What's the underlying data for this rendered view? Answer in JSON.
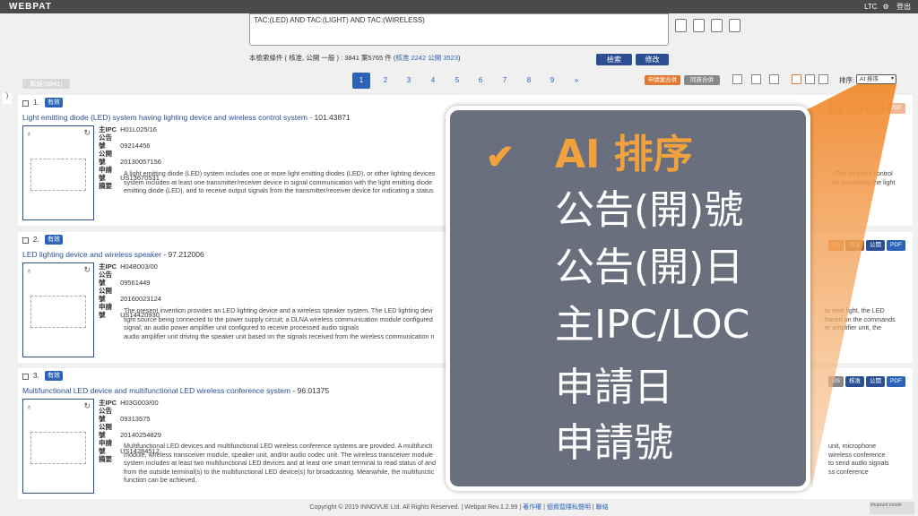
{
  "app": {
    "logo": "WEBPAT",
    "user": "LTC",
    "logout": "登出"
  },
  "search": {
    "query": "TAC:(LED) AND TAC:(LIGHT) AND TAC:(WIRELESS)",
    "info_prefix": "本檢索條件 ( 核准, 公開 一般 ) : 3841 案5765 件 (",
    "granted": "核准 2242",
    "published": "公開 3523",
    "info_suffix": ")",
    "search_btn": "檢索",
    "edit_btn": "修改"
  },
  "count_pill": "聯紙(3841)",
  "pagination": {
    "pages": [
      "1",
      "2",
      "3",
      "4",
      "5",
      "6",
      "7",
      "8",
      "9",
      "»"
    ],
    "active": "1"
  },
  "toolbar": {
    "merge_app": "申請案合併",
    "merge_family": "同族合併",
    "sort_label": "排序:",
    "sort_value": "AI 排序"
  },
  "results": [
    {
      "num": "1.",
      "status": "有效",
      "title": "Light emitting diode (LED) system having lighting device and wireless control system",
      "score": " - 101.43871",
      "ipc": "H01L025/16",
      "pub_no": "09214456",
      "pub_date": "20130057156",
      "app_no": "US13670531",
      "abstract": [
        "A light emitting diode (LED) system includes one or more light emitting diodes (LED), or other lighting devices",
        "system includes at least one transmitter/receiver device in signal communication with the light emitting diode",
        "emitting diode (LED), and to receive output signals from the transmitter/receiver device for indicating a status"
      ],
      "abstract_right": [
        ". The wireless control",
        "for controlling the light",
        ""
      ],
      "btns": [
        "US",
        "核准",
        "公開",
        "PDF"
      ]
    },
    {
      "num": "2.",
      "status": "有效",
      "title": "LED lighting device and wireless speaker",
      "score": " - 97.212006",
      "ipc": "H04B003/00",
      "pub_no": "09561449",
      "pub_date": "20160023124",
      "app_no": "US14420930",
      "abstract": [
        "The present invention provides an LED lighting device and a wireless speaker system. The LED lighting devi",
        "light source being connected to the power supply circuit; a DLNA wireless communication module configured",
        "signal; an audio power amplifier unit configured to receive processed audio signals",
        "audio amplifier unit driving the speaker unit based on the signals received from the wireless communication n"
      ],
      "abstract_right": [
        "to emit light, the LED",
        "based on the commands",
        "er amplifier unit, the",
        ""
      ],
      "btns": [
        "US",
        "核准",
        "公開",
        "PDF"
      ]
    },
    {
      "num": "3.",
      "status": "有效",
      "title": "Multifunctional LED device and multifunctional LED wireless conference system",
      "score": " - 96.01375",
      "ipc": "H03G003/00",
      "pub_no": "09313575",
      "pub_date": "20140254829",
      "app_no": "US14284512",
      "abstract": [
        "Multifunctional LED devices and multifunctional LED wireless conference systems are provided. A multifuncti",
        "module, wireless transceiver module, speaker unit, and/or audio codec unit. The wireless transceiver module",
        "system includes at least two multifunctional LED devices and at least one smart terminal to read status of and",
        "from the outside terminal(s) to the multifunctional LED device(s) for broadcasting. Meanwhile, the multifunctic",
        "function can be achieved."
      ],
      "abstract_right": [
        "unit, microphone",
        "wireless conference",
        "to send audio signals",
        "ss conference",
        ""
      ],
      "btns": [
        "US",
        "核准",
        "公開",
        "PDF"
      ]
    }
  ],
  "meta_labels": {
    "ipc": "主IPC",
    "pub_no": "公告號",
    "pub_date": "公開號",
    "app_no": "申請號",
    "abstract": "摘要"
  },
  "sort_menu": {
    "items": [
      "AI 排序",
      "公告(開)號",
      "公告(開)日",
      "主IPC/LOC",
      "申請日",
      "申請號"
    ],
    "selected": "AI 排序"
  },
  "footer": {
    "copyright": "Copyright © 2019 INNOVUE Ltd. All Rights Reserved. | Webpat Rev.1.2.99 |",
    "author": "著作權",
    "privacy": "個資暨隱私聲明",
    "contact": "聯絡"
  },
  "corner_badge": "ithuprunt monkt",
  "colors": {
    "accent": "#2b63b7",
    "dark_blue": "#2b4f92",
    "orange": "#e07a2e",
    "overlay_bg": "#6a6f7e",
    "highlight": "#f2a23c"
  }
}
